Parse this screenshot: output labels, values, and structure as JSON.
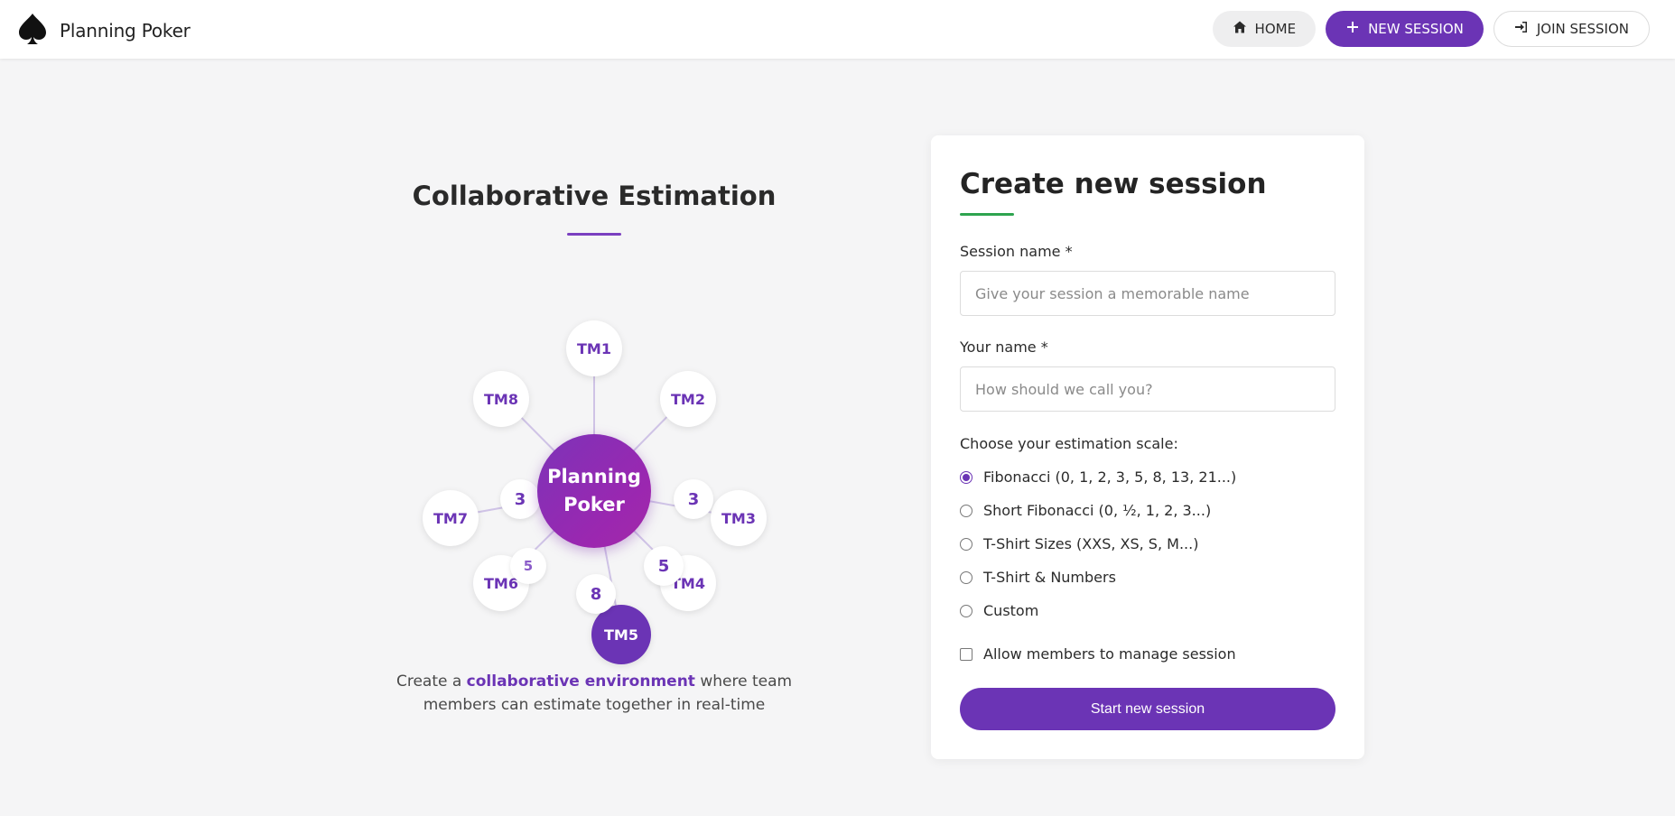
{
  "app": {
    "title": "Planning Poker"
  },
  "nav": {
    "home": "HOME",
    "new_session": "NEW SESSION",
    "join_session": "JOIN SESSION"
  },
  "hero": {
    "title": "Collaborative Estimation",
    "center_line1": "Planning",
    "center_line2": "Poker",
    "members": [
      "TM1",
      "TM2",
      "TM3",
      "TM4",
      "TM5",
      "TM6",
      "TM7",
      "TM8"
    ],
    "cards": [
      "3",
      "3",
      "5",
      "8",
      "5"
    ],
    "desc_before": "Create a ",
    "desc_highlight": "collaborative environment",
    "desc_after": " where team members can estimate together in real-time"
  },
  "form": {
    "title": "Create new session",
    "session_label": "Session name *",
    "session_placeholder": "Give your session a memorable name",
    "name_label": "Your name *",
    "name_placeholder": "How should we call you?",
    "scale_label": "Choose your estimation scale:",
    "scales": [
      {
        "label": "Fibonacci (0, 1, 2, 3, 5, 8, 13, 21...)",
        "checked": true
      },
      {
        "label": "Short Fibonacci (0, ½, 1, 2, 3...)",
        "checked": false
      },
      {
        "label": "T-Shirt Sizes (XXS, XS, S, M...)",
        "checked": false
      },
      {
        "label": "T-Shirt & Numbers",
        "checked": false
      },
      {
        "label": "Custom",
        "checked": false
      }
    ],
    "allow_manage_label": "Allow members to manage session",
    "allow_manage_checked": false,
    "submit_label": "Start new session"
  },
  "colors": {
    "accent": "#6b34b5",
    "underline_green": "#2ea44f"
  }
}
